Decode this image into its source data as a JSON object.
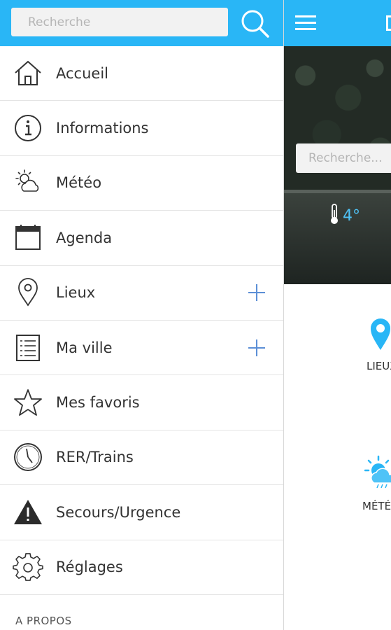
{
  "drawer": {
    "search": {
      "placeholder": "Recherche"
    },
    "items": [
      {
        "label": "Accueil",
        "icon": "home-icon",
        "expandable": false
      },
      {
        "label": "Informations",
        "icon": "info-icon",
        "expandable": false
      },
      {
        "label": "Météo",
        "icon": "weather-icon",
        "expandable": false
      },
      {
        "label": "Agenda",
        "icon": "calendar-icon",
        "expandable": false
      },
      {
        "label": "Lieux",
        "icon": "location-pin-icon",
        "expandable": true
      },
      {
        "label": "Ma ville",
        "icon": "list-icon",
        "expandable": true
      },
      {
        "label": "Mes favoris",
        "icon": "star-icon",
        "expandable": false
      },
      {
        "label": "RER/Trains",
        "icon": "clock-icon",
        "expandable": false
      },
      {
        "label": "Secours/Urgence",
        "icon": "warning-icon",
        "expandable": false
      },
      {
        "label": "Réglages",
        "icon": "gear-icon",
        "expandable": false
      }
    ],
    "about_label": "A PROPOS"
  },
  "main": {
    "search": {
      "placeholder": "Recherche..."
    },
    "temperature": "4°",
    "tiles": [
      {
        "label": "LIEUX",
        "icon": "location-pin-icon"
      },
      {
        "label": "MÉTÉ",
        "icon": "weather-icon"
      }
    ]
  },
  "colors": {
    "header": "#29b6f6",
    "accent": "#4fc3f7",
    "plus": "#5c8fd6"
  }
}
